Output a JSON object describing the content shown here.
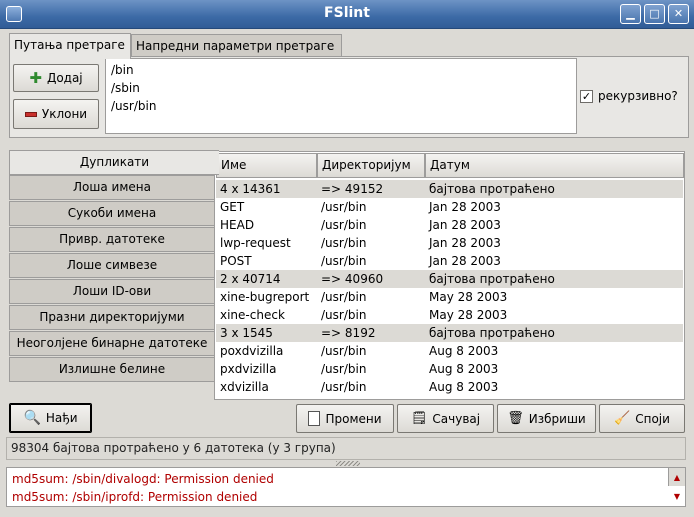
{
  "window": {
    "title": "FSlint"
  },
  "top_tabs": [
    {
      "label": "Путања претраге",
      "active": true
    },
    {
      "label": "Напредни параметри претраге",
      "active": false
    }
  ],
  "search_path": {
    "add_label": "Додај",
    "remove_label": "Уклони",
    "paths": [
      "/bin",
      "/sbin",
      "/usr/bin"
    ],
    "recursive_label": "рекурзивно?",
    "recursive_checked": true
  },
  "side_tabs": [
    "Дупликати",
    "Лоша имена",
    "Сукоби имена",
    "Привр. датотеке",
    "Лоше симвезе",
    "Лоши ID-ови",
    "Празни директоријуми",
    "Неоголјене бинарне датотеке",
    "Излишне белине"
  ],
  "table": {
    "headers": [
      "Име",
      "Директоријум",
      "Датум"
    ],
    "rows": [
      {
        "group": true,
        "cells": [
          "4 x 14361",
          "=> 49152",
          "бајтова протраћено"
        ]
      },
      {
        "group": false,
        "cells": [
          "GET",
          "/usr/bin",
          "Jan 28 2003"
        ]
      },
      {
        "group": false,
        "cells": [
          "HEAD",
          "/usr/bin",
          "Jan 28 2003"
        ]
      },
      {
        "group": false,
        "cells": [
          "lwp-request",
          "/usr/bin",
          "Jan 28 2003"
        ]
      },
      {
        "group": false,
        "cells": [
          "POST",
          "/usr/bin",
          "Jan 28 2003"
        ]
      },
      {
        "group": true,
        "cells": [
          "2 x 40714",
          "=> 40960",
          "бајтова протраћено"
        ]
      },
      {
        "group": false,
        "cells": [
          "xine-bugreport",
          "/usr/bin",
          "May 28 2003"
        ]
      },
      {
        "group": false,
        "cells": [
          "xine-check",
          "/usr/bin",
          "May 28 2003"
        ]
      },
      {
        "group": true,
        "cells": [
          "3 x 1545",
          "=> 8192",
          "бајтова протраћено"
        ]
      },
      {
        "group": false,
        "cells": [
          "poxdvizilla",
          "/usr/bin",
          "Aug  8 2003"
        ]
      },
      {
        "group": false,
        "cells": [
          "pxdvizilla",
          "/usr/bin",
          "Aug  8 2003"
        ]
      },
      {
        "group": false,
        "cells": [
          "xdvizilla",
          "/usr/bin",
          "Aug  8 2003"
        ]
      }
    ]
  },
  "actions": {
    "find_label": "Нађи",
    "rename_label": "Промени",
    "save_label": "Сачувај",
    "delete_label": "Избриши",
    "merge_label": "Споји"
  },
  "status_text": "98304 бајтова протраћено у 6 датотека (у 3 група)",
  "log_lines": [
    "md5sum: /sbin/divalogd: Permission denied",
    "md5sum: /sbin/iprofd: Permission denied"
  ],
  "colors": {
    "titlebar": "#3c6aa6",
    "error_text": "#b00000"
  }
}
